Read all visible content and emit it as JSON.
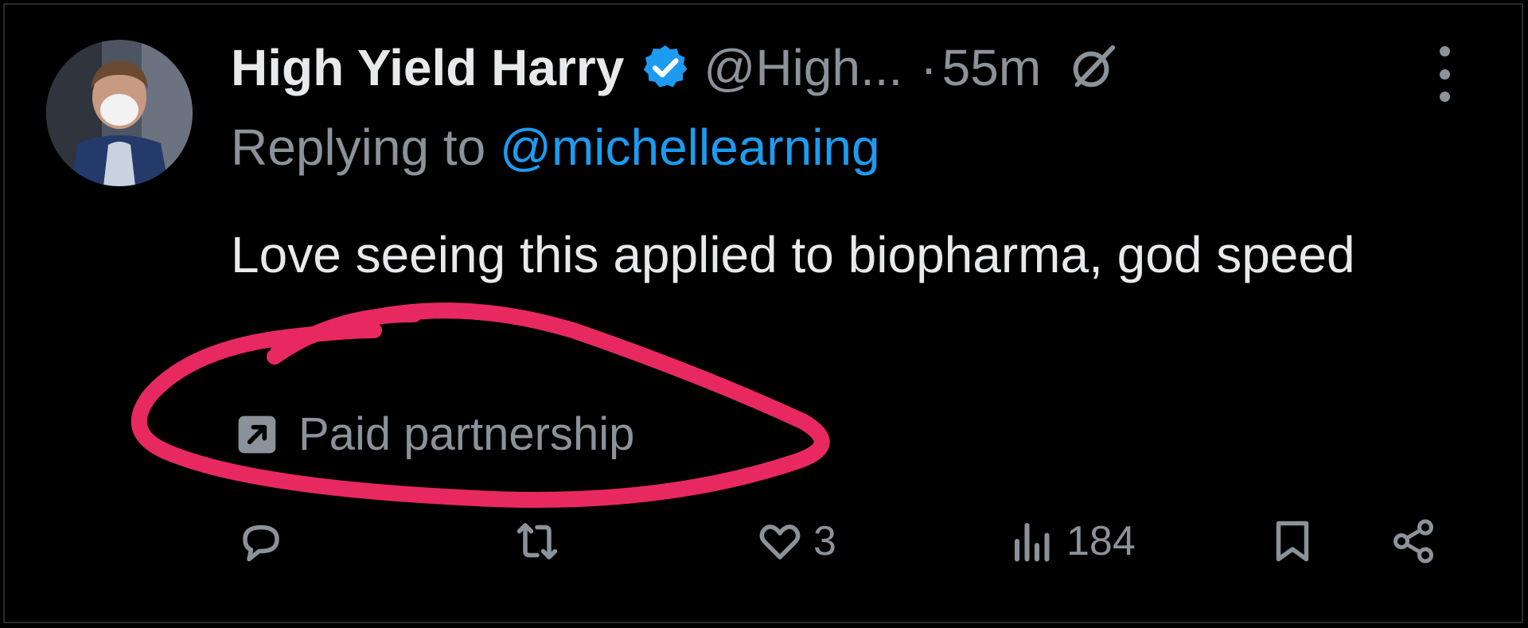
{
  "tweet": {
    "author_name": "High Yield Harry",
    "handle": "@High...",
    "separator": "·",
    "time": "55m",
    "replying_prefix": "Replying to",
    "replying_to": "@michellearning",
    "text": "Love seeing this applied to biopharma, god speed",
    "paid_label": "Paid partnership"
  },
  "actions": {
    "likes": "3",
    "views": "184"
  },
  "icons": {
    "verified": "verified-badge-icon",
    "grok": "grok-icon",
    "more": "more-icon",
    "paid": "paid-partnership-icon",
    "reply": "reply-icon",
    "retweet": "retweet-icon",
    "like": "heart-icon",
    "views": "views-icon",
    "bookmark": "bookmark-icon",
    "share": "share-icon"
  },
  "colors": {
    "background": "#000000",
    "text": "#e7e9ea",
    "muted": "#8b9299",
    "link": "#1d9bf0",
    "verified": "#1d9bf0",
    "annotation": "#e8295f"
  }
}
